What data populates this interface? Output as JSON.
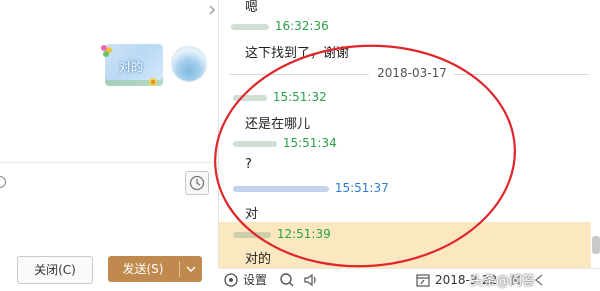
{
  "chat_input": {
    "outgoing_bubble_text": "对的",
    "close_button_label": "关闭(C)",
    "send_button_label": "发送(S)"
  },
  "history": {
    "messages": [
      {
        "type": "text",
        "text": "嗯"
      },
      {
        "type": "meta",
        "time": "16:32:36",
        "color": "green"
      },
      {
        "type": "text",
        "text": "这下找到了，谢谢"
      },
      {
        "type": "date",
        "text": "2018-03-17"
      },
      {
        "type": "meta",
        "time": "15:51:32",
        "color": "green"
      },
      {
        "type": "text",
        "text": "还是在哪儿"
      },
      {
        "type": "meta",
        "time": "15:51:34",
        "color": "green"
      },
      {
        "type": "text",
        "text": "?"
      },
      {
        "type": "meta",
        "time": "15:51:37",
        "color": "blue"
      },
      {
        "type": "text",
        "text": "对"
      },
      {
        "type": "meta",
        "time": "12:51:39",
        "color": "green"
      },
      {
        "type": "text",
        "text": "对的"
      }
    ]
  },
  "bottom_bar": {
    "settings_label": "设置",
    "date_label": "2018-3-22",
    "watermark": "头条@问答"
  },
  "colors": {
    "send_button": "#c08a4f",
    "highlight_row": "#fbe8c0",
    "annotation_ellipse": "#e0262b",
    "time_green": "#2aa14a",
    "time_blue": "#2f7fd0"
  }
}
